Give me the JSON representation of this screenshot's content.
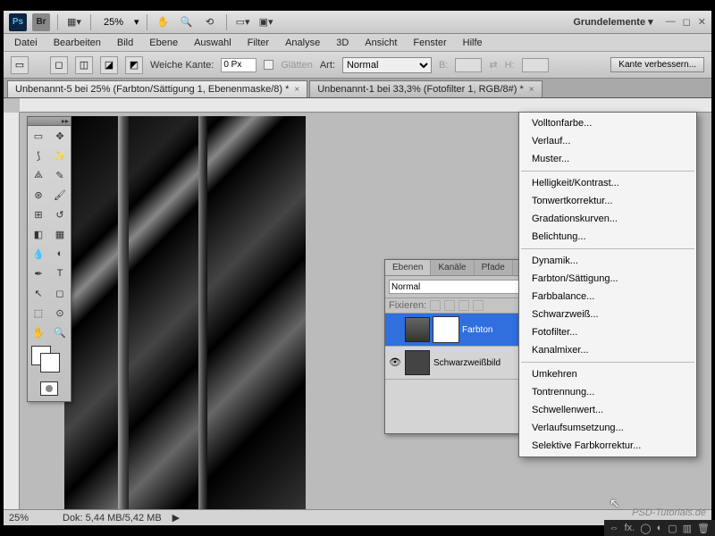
{
  "topbar": {
    "zoom": "25%",
    "workspace": "Grundelemente ▾"
  },
  "menu": [
    "Datei",
    "Bearbeiten",
    "Bild",
    "Ebene",
    "Auswahl",
    "Filter",
    "Analyse",
    "3D",
    "Ansicht",
    "Fenster",
    "Hilfe"
  ],
  "optbar": {
    "weiche_kante_label": "Weiche Kante:",
    "weiche_kante_value": "0 Px",
    "glaetten": "Glätten",
    "art_label": "Art:",
    "art_value": "Normal",
    "b_label": "B:",
    "h_label": "H:",
    "refine": "Kante verbessern..."
  },
  "tabs": [
    {
      "label": "Unbenannt-5 bei 25% (Farbton/Sättigung 1, Ebenenmaske/8) *",
      "active": true
    },
    {
      "label": "Unbenannt-1 bei 33,3% (Fotofilter 1, RGB/8#) *",
      "active": false
    }
  ],
  "layers_panel": {
    "tabs": [
      "Ebenen",
      "Kanäle",
      "Pfade"
    ],
    "blend_mode": "Normal",
    "lock_label": "Fixieren:",
    "layers": [
      {
        "name": "Farbton",
        "selected": true,
        "adj": true
      },
      {
        "name": "Schwarzweißbild",
        "selected": false,
        "adj": false
      }
    ]
  },
  "context_menu": {
    "groups": [
      [
        "Volltonfarbe...",
        "Verlauf...",
        "Muster..."
      ],
      [
        "Helligkeit/Kontrast...",
        "Tonwertkorrektur...",
        "Gradationskurven...",
        "Belichtung..."
      ],
      [
        "Dynamik...",
        "Farbton/Sättigung...",
        "Farbbalance...",
        "Schwarzweiß...",
        "Fotofilter...",
        "Kanalmixer..."
      ],
      [
        "Umkehren",
        "Tontrennung...",
        "Schwellenwert...",
        "Verlaufsumsetzung...",
        "Selektive Farbkorrektur..."
      ]
    ]
  },
  "statusbar": {
    "zoom": "25%",
    "doc": "Dok: 5,44 MB/5,42 MB"
  },
  "watermark": "PSD-Tutorials.de",
  "bottombar_icons": [
    "fx.",
    "◯",
    "◐",
    "▢",
    "▥",
    "🗑"
  ]
}
